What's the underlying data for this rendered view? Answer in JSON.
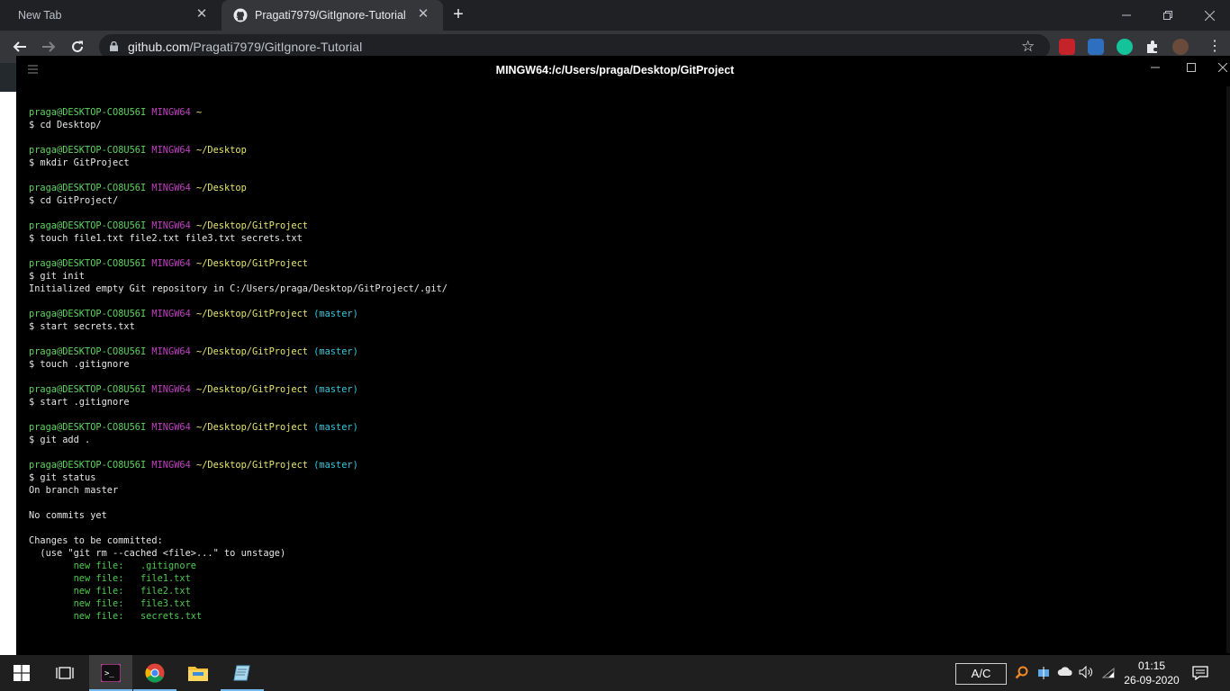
{
  "browser": {
    "tabs": [
      {
        "title": "New Tab",
        "active": false
      },
      {
        "title": "Pragati7979/GitIgnore-Tutorial",
        "active": true
      }
    ],
    "close_glyph": "✕",
    "new_tab_glyph": "+",
    "url_host": "github.com",
    "url_path": "/Pragati7979/GitIgnore-Tutorial"
  },
  "terminal": {
    "title": "MINGW64:/c/Users/praga/Desktop/GitProject",
    "lines": [
      {
        "type": "prompt",
        "user": "praga@DESKTOP-CO8U56I",
        "sys": "MINGW64",
        "path": "~",
        "branch": ""
      },
      {
        "type": "text",
        "text": "$ cd Desktop/"
      },
      {
        "type": "blank"
      },
      {
        "type": "prompt",
        "user": "praga@DESKTOP-CO8U56I",
        "sys": "MINGW64",
        "path": "~/Desktop",
        "branch": ""
      },
      {
        "type": "text",
        "text": "$ mkdir GitProject"
      },
      {
        "type": "blank"
      },
      {
        "type": "prompt",
        "user": "praga@DESKTOP-CO8U56I",
        "sys": "MINGW64",
        "path": "~/Desktop",
        "branch": ""
      },
      {
        "type": "text",
        "text": "$ cd GitProject/"
      },
      {
        "type": "blank"
      },
      {
        "type": "prompt",
        "user": "praga@DESKTOP-CO8U56I",
        "sys": "MINGW64",
        "path": "~/Desktop/GitProject",
        "branch": ""
      },
      {
        "type": "text",
        "text": "$ touch file1.txt file2.txt file3.txt secrets.txt"
      },
      {
        "type": "blank"
      },
      {
        "type": "prompt",
        "user": "praga@DESKTOP-CO8U56I",
        "sys": "MINGW64",
        "path": "~/Desktop/GitProject",
        "branch": ""
      },
      {
        "type": "text",
        "text": "$ git init"
      },
      {
        "type": "text",
        "text": "Initialized empty Git repository in C:/Users/praga/Desktop/GitProject/.git/"
      },
      {
        "type": "blank"
      },
      {
        "type": "prompt",
        "user": "praga@DESKTOP-CO8U56I",
        "sys": "MINGW64",
        "path": "~/Desktop/GitProject",
        "branch": "(master)"
      },
      {
        "type": "text",
        "text": "$ start secrets.txt"
      },
      {
        "type": "blank"
      },
      {
        "type": "prompt",
        "user": "praga@DESKTOP-CO8U56I",
        "sys": "MINGW64",
        "path": "~/Desktop/GitProject",
        "branch": "(master)"
      },
      {
        "type": "text",
        "text": "$ touch .gitignore"
      },
      {
        "type": "blank"
      },
      {
        "type": "prompt",
        "user": "praga@DESKTOP-CO8U56I",
        "sys": "MINGW64",
        "path": "~/Desktop/GitProject",
        "branch": "(master)"
      },
      {
        "type": "text",
        "text": "$ start .gitignore"
      },
      {
        "type": "blank"
      },
      {
        "type": "prompt",
        "user": "praga@DESKTOP-CO8U56I",
        "sys": "MINGW64",
        "path": "~/Desktop/GitProject",
        "branch": "(master)"
      },
      {
        "type": "text",
        "text": "$ git add ."
      },
      {
        "type": "blank"
      },
      {
        "type": "prompt",
        "user": "praga@DESKTOP-CO8U56I",
        "sys": "MINGW64",
        "path": "~/Desktop/GitProject",
        "branch": "(master)"
      },
      {
        "type": "text",
        "text": "$ git status"
      },
      {
        "type": "text",
        "text": "On branch master"
      },
      {
        "type": "blank"
      },
      {
        "type": "text",
        "text": "No commits yet"
      },
      {
        "type": "blank"
      },
      {
        "type": "text",
        "text": "Changes to be committed:"
      },
      {
        "type": "text",
        "text": "  (use \"git rm --cached <file>...\" to unstage)"
      },
      {
        "type": "green",
        "text": "        new file:   .gitignore"
      },
      {
        "type": "green",
        "text": "        new file:   file1.txt"
      },
      {
        "type": "green",
        "text": "        new file:   file2.txt"
      },
      {
        "type": "green",
        "text": "        new file:   file3.txt"
      },
      {
        "type": "green",
        "text": "        new file:   secrets.txt"
      }
    ]
  },
  "taskbar": {
    "ac_label": "A/C",
    "time": "01:15",
    "date": "26-09-2020"
  },
  "colors": {
    "prompt_user": "#5fd35f",
    "prompt_sys": "#c040c0",
    "prompt_path": "#e6e670",
    "prompt_branch": "#35c8dd",
    "staged_file": "#4ec94e"
  }
}
